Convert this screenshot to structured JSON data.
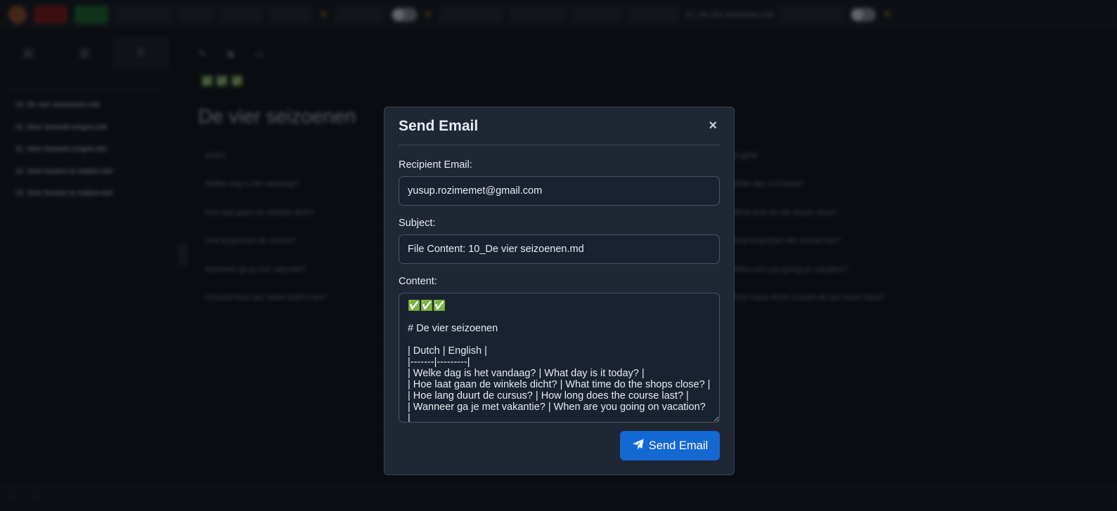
{
  "background": {
    "topbar": {
      "buttons": [
        "",
        "",
        "",
        "",
        "",
        "",
        "",
        "",
        "",
        "",
        ""
      ],
      "file_name_text": "10_De vier seizoenen.md"
    },
    "sidebar": {
      "items": [
        {
          "title": "10_De vier seizoenen.md",
          "meta": ""
        },
        {
          "title": "11_Voor iemand zorgen.md",
          "meta": ""
        },
        {
          "title": "11_Voor iemand zorgen.md",
          "meta": ""
        },
        {
          "title": "12_Voor kosten te maken.md",
          "meta": ""
        },
        {
          "title": "13_Voor kosten te maken.md",
          "meta": ""
        }
      ]
    },
    "main": {
      "checks": "✅✅✅",
      "title": "De vier seizoenen",
      "table_header": [
        "Dutch",
        "English"
      ],
      "rows": [
        [
          "Welke dag is het vandaag?",
          "What day is it today?"
        ],
        [
          "Hoe laat gaan de winkels dicht?",
          "What time do the shops close?"
        ],
        [
          "Hoe lang duurt de cursus?",
          "How long does the course last?"
        ],
        [
          "Wanneer ga je met vakantie?",
          "When are you going on vacation?"
        ],
        [
          "Hoeveel keer per week heeft u les?",
          "How many times a week do you have class?"
        ],
        [
          "",
          ""
        ],
        [
          "",
          ""
        ],
        [
          "",
          ""
        ],
        [
          "",
          ""
        ],
        [
          "",
          ""
        ]
      ]
    }
  },
  "modal": {
    "title": "Send Email",
    "close_glyph": "×",
    "recipient_label": "Recipient Email:",
    "recipient_value": "yusup.rozimemet@gmail.com",
    "subject_label": "Subject:",
    "subject_value": "File Content: 10_De vier seizoenen.md",
    "content_label": "Content:",
    "content_value": "✅✅✅\n\n# De vier seizoenen\n\n| Dutch | English |\n|-------|---------|\n| Welke dag is het vandaag? | What day is it today? |\n| Hoe laat gaan de winkels dicht? | What time do the shops close? |\n| Hoe lang duurt de cursus? | How long does the course last? |\n| Wanneer ga je met vakantie? | When are you going on vacation? |\n| Hoeveel keer per week heeft u les? | How many times a week do you have class? |",
    "send_label": "Send Email",
    "send_icon": "paper-plane-icon",
    "accent_color": "#1468d2"
  }
}
